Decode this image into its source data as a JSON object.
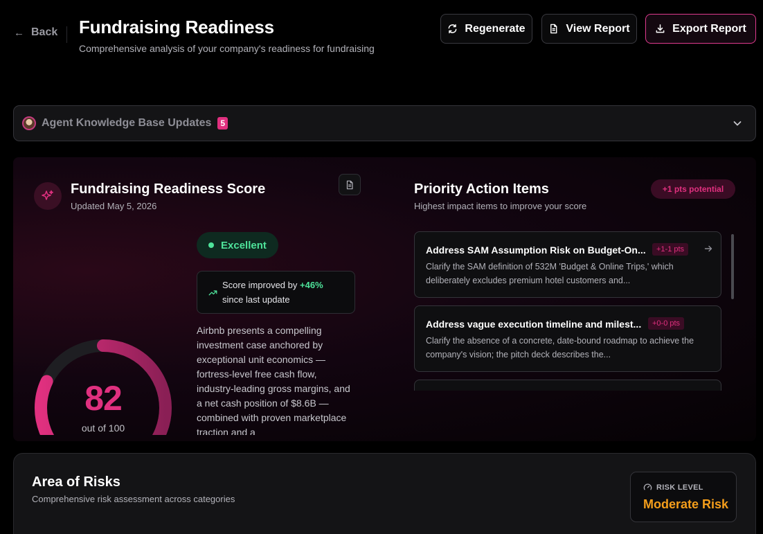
{
  "header": {
    "back_label": "Back",
    "title": "Fundraising Readiness",
    "subtitle": "Comprehensive analysis of your company's readiness for fundraising",
    "buttons": {
      "regenerate": "Regenerate",
      "view_report": "View Report",
      "export_report": "Export Report"
    }
  },
  "knowledge_bar": {
    "label": "Agent Knowledge Base Updates",
    "badge_count": "5"
  },
  "score": {
    "title": "Fundraising Readiness Score",
    "updated": "Updated May 5, 2026",
    "value": "82",
    "value_fraction": 0.82,
    "out_of": "out of 100",
    "status": "Excellent",
    "improvement_prefix": "Score improved by",
    "improvement_value": "+46%",
    "improvement_suffix": "since last update",
    "summary": "Airbnb presents a compelling investment case anchored by exceptional unit economics — fortress-level free cash flow, industry-leading gross margins, and a net cash position of $8.6B — combined with proven marketplace traction and a"
  },
  "priority": {
    "title": "Priority Action Items",
    "subtitle": "Highest impact items to improve your score",
    "potential": "+1 pts potential",
    "items": [
      {
        "title": "Address SAM Assumption Risk on Budget-On...",
        "points": "+1-1 pts",
        "description": "Clarify the SAM definition of 532M 'Budget & Online Trips,' which deliberately excludes premium hotel customers and..."
      },
      {
        "title": "Address vague execution timeline and milest...",
        "points": "+0-0 pts",
        "description": "Clarify the absence of a concrete, date-bound roadmap to achieve the company's vision; the pitch deck describes the..."
      }
    ]
  },
  "risks": {
    "title": "Area of Risks",
    "subtitle": "Comprehensive risk assessment across categories",
    "level_label": "RISK LEVEL",
    "level_value": "Moderate Risk"
  },
  "colors": {
    "accent": "#e0307f",
    "success": "#4ee39a",
    "warning": "#f59e1b"
  }
}
